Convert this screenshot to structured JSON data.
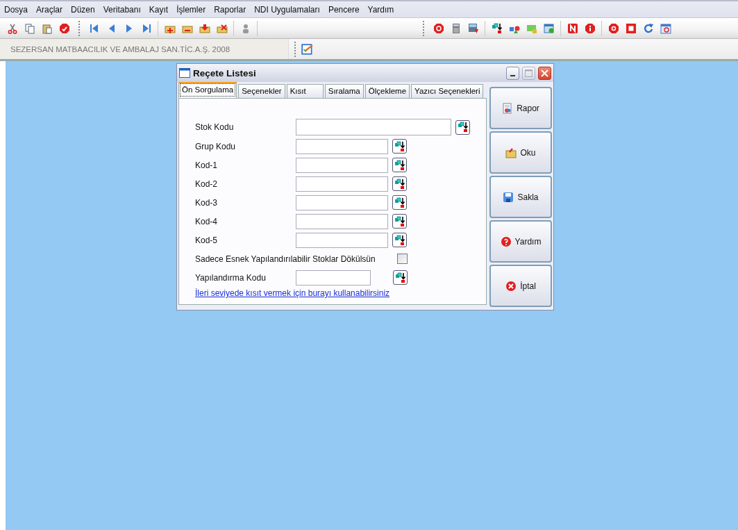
{
  "menu": [
    {
      "label": "Dosya"
    },
    {
      "label": "Araçlar"
    },
    {
      "label": "Düzen"
    },
    {
      "label": "Veritabanı"
    },
    {
      "label": "Kayıt"
    },
    {
      "label": "İşlemler"
    },
    {
      "label": "Raporlar"
    },
    {
      "label": "NDI Uygulamaları"
    },
    {
      "label": "Pencere"
    },
    {
      "label": "Yardım"
    }
  ],
  "company": "SEZERSAN MATBAACILIK VE AMBALAJ SAN.TİC.A.Ş. 2008",
  "dialog": {
    "title": "Reçete Listesi",
    "tabs": [
      {
        "label": "Ön Sorgulama",
        "selected": true
      },
      {
        "label": "Seçenekler",
        "selected": false
      },
      {
        "label": "Kısıt",
        "selected": false
      },
      {
        "label": "Sıralama",
        "selected": false
      },
      {
        "label": "Ölçekleme",
        "selected": false
      },
      {
        "label": "Yazıcı Seçenekleri",
        "selected": false
      }
    ],
    "fields": [
      {
        "kind": "wide",
        "label": "Stok Kodu"
      },
      {
        "kind": "lookup",
        "label": "Grup Kodu"
      },
      {
        "kind": "lookup",
        "label": "Kod-1"
      },
      {
        "kind": "lookup",
        "label": "Kod-2"
      },
      {
        "kind": "lookup",
        "label": "Kod-3"
      },
      {
        "kind": "lookup",
        "label": "Kod-4"
      },
      {
        "kind": "lookup",
        "label": "Kod-5"
      },
      {
        "kind": "checkbox",
        "label": "Sadece Esnek Yapılandırılabilir Stoklar Dökülsün",
        "checked": false
      },
      {
        "kind": "short",
        "label": "Yapılandırma Kodu"
      }
    ],
    "link": "İleri seviyede kısıt vermek için burayı kullanabilirsiniz",
    "buttons": [
      {
        "label": "Rapor"
      },
      {
        "label": "Oku"
      },
      {
        "label": "Sakla"
      },
      {
        "label": "Yardım"
      },
      {
        "label": "İptal"
      }
    ]
  }
}
